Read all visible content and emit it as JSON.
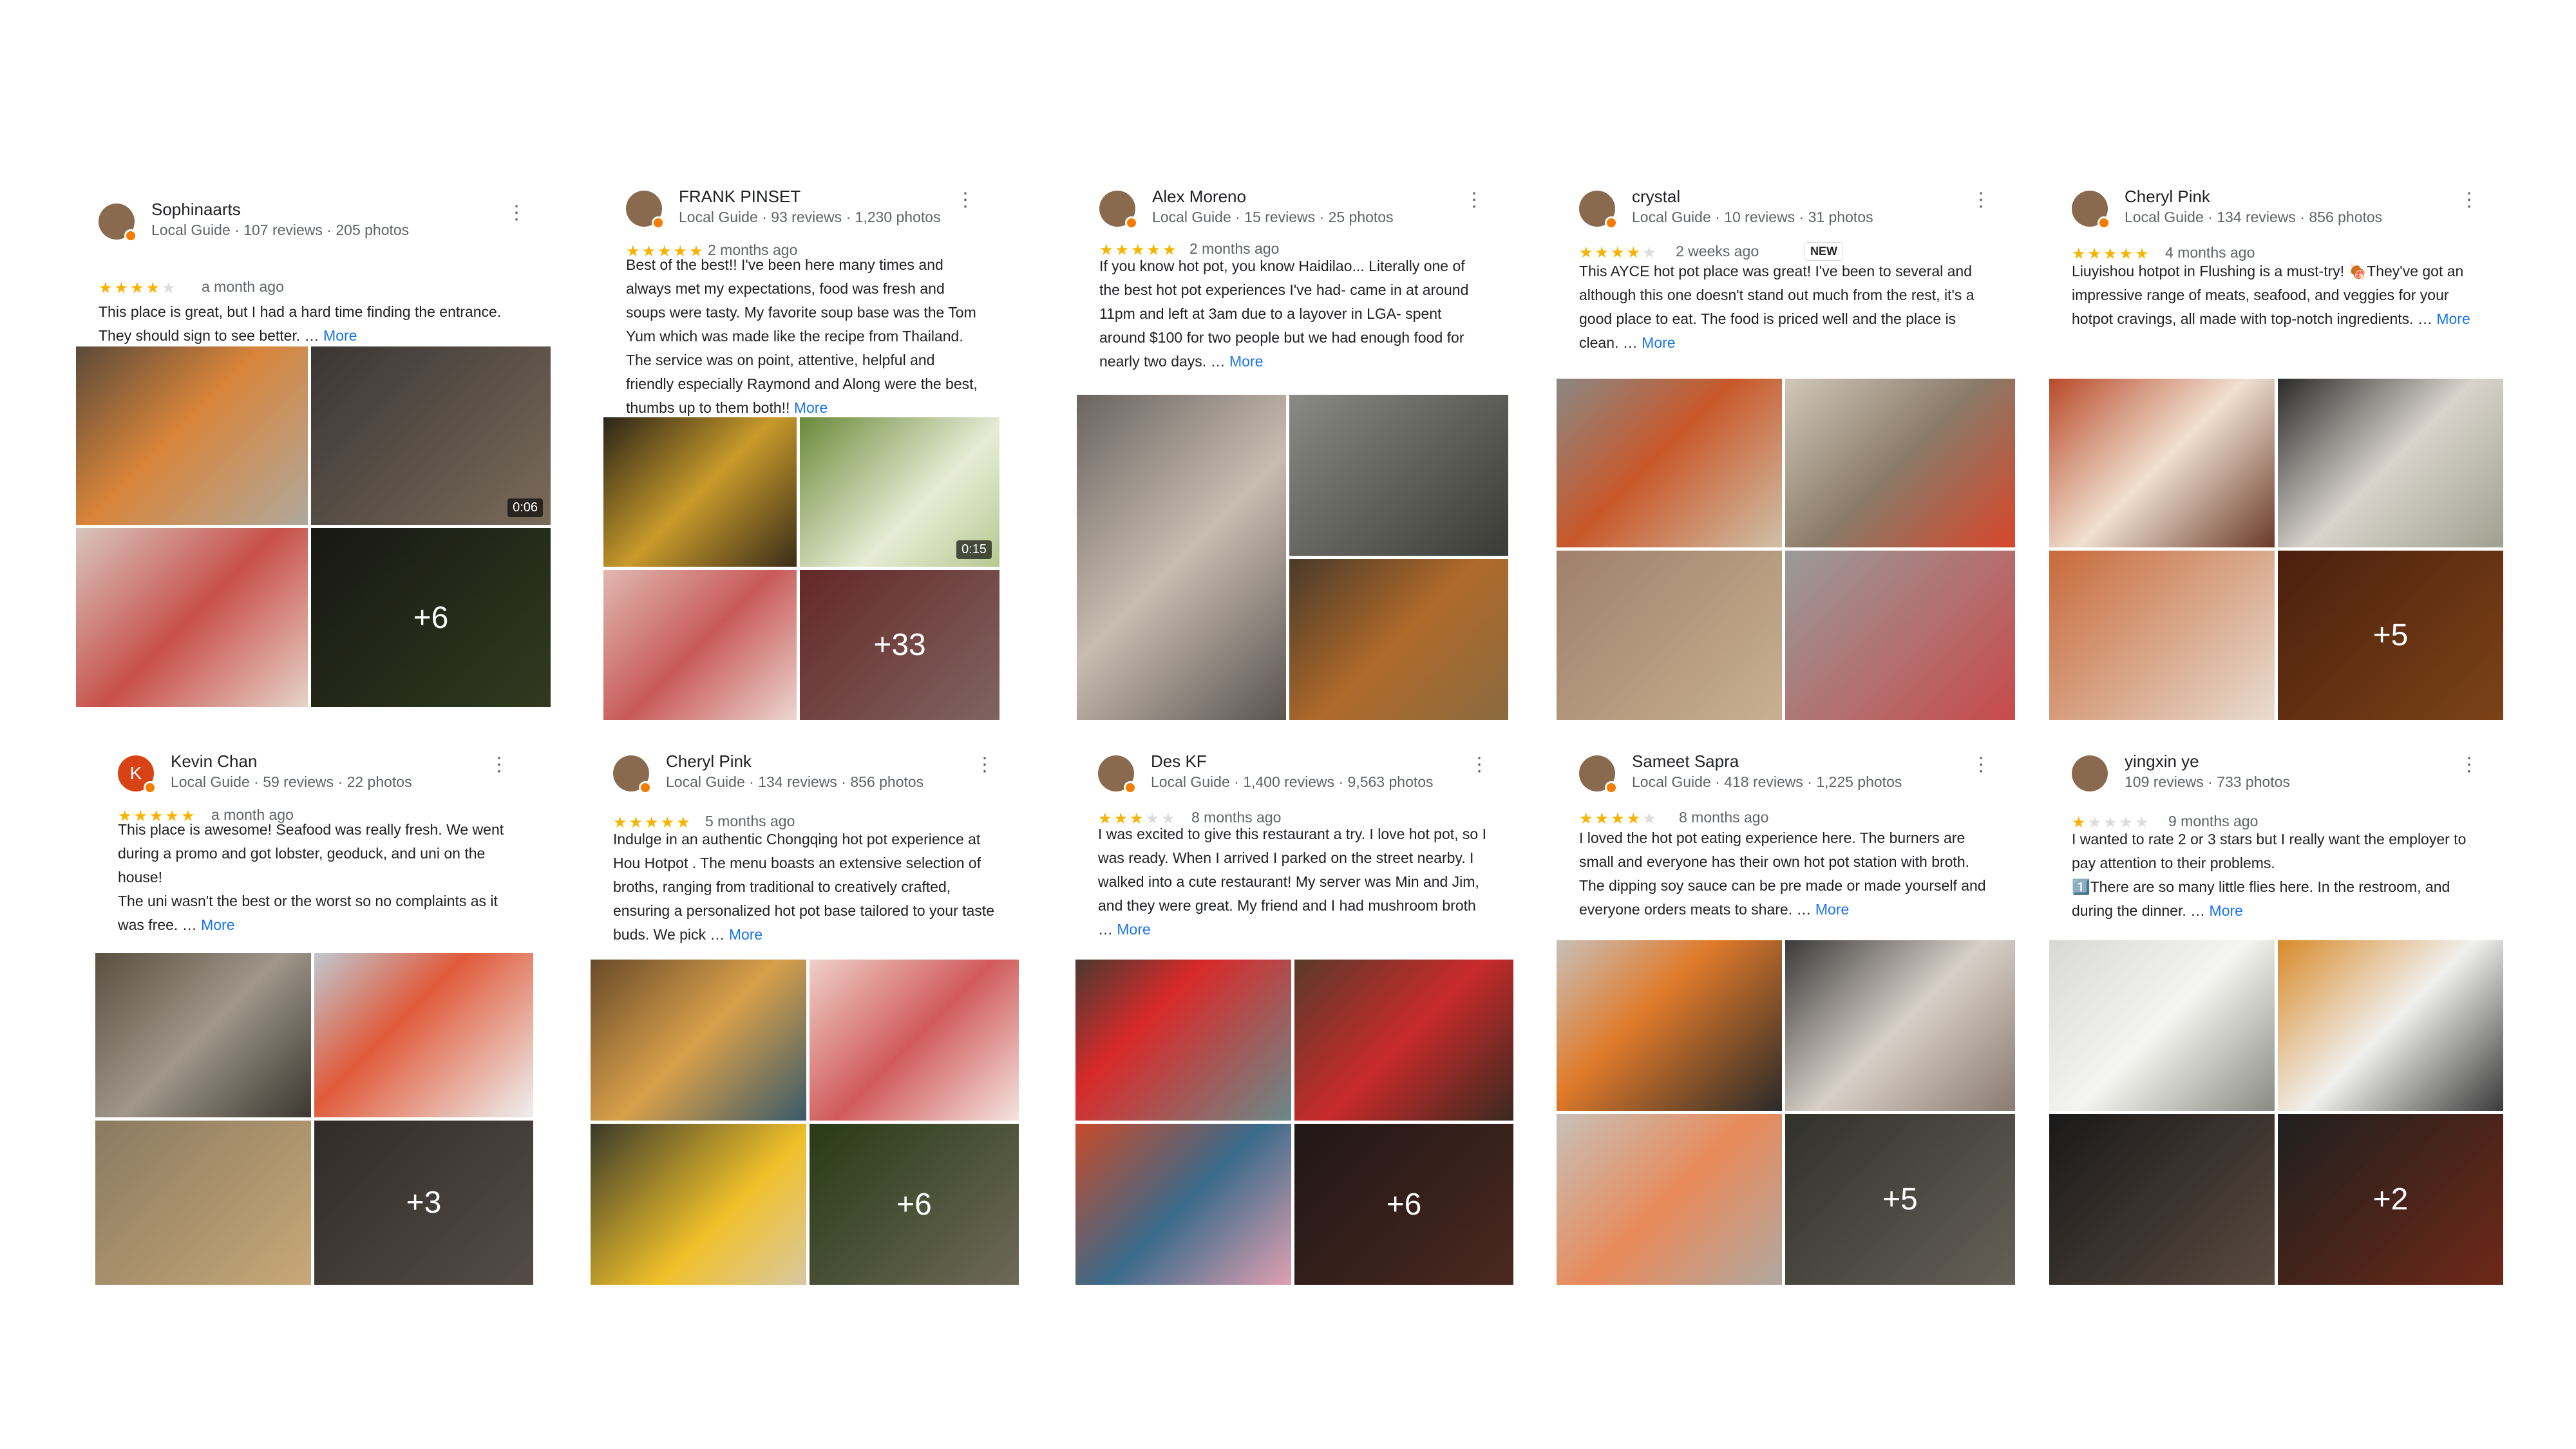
{
  "reviews": [
    {
      "name": "Sophinaarts",
      "meta": "Local Guide · 107 reviews · 205 photos",
      "stars": 4,
      "when": "a month ago",
      "text": "This place is great, but I had a hard time finding the entrance. They should sign to see better. …",
      "more": "More",
      "duration": "0:06",
      "extra": "+6"
    },
    {
      "name": "FRANK PINSET",
      "meta": "Local Guide · 93 reviews · 1,230 photos",
      "stars": 5,
      "when": "2 months ago",
      "text": "Best of the best!! I've been here many times and always met my expectations, food was fresh and soups were tasty. My favorite soup base was the Tom Yum which was made like the recipe from Thailand. The service was on point, attentive, helpful and friendly especially Raymond and Along were the best, thumbs up to them both!!",
      "more": "More",
      "duration": "0:15",
      "extra": "+33"
    },
    {
      "name": "Alex Moreno",
      "meta": "Local Guide · 15 reviews · 25 photos",
      "stars": 5,
      "when": "2 months ago",
      "text": "If you know hot pot, you know Haidilao... Literally one of the best hot pot experiences I've had- came in at around 11pm and left at 3am due to a layover in LGA- spent around $100 for two people but we had enough food for nearly two days. …",
      "more": "More"
    },
    {
      "name": "crystal",
      "meta": "Local Guide · 10 reviews · 31 photos",
      "stars": 4,
      "when": "2 weeks ago",
      "tag": "NEW",
      "text": "This AYCE hot pot place was great! I've been to several and although this one doesn't stand out much from the rest, it's a good place to eat. The food is priced well and the place is clean. …",
      "more": "More"
    },
    {
      "name": "Cheryl Pink",
      "meta": "Local Guide · 134 reviews · 856 photos",
      "stars": 5,
      "when": "4 months ago",
      "text": "Liuyishou hotpot in Flushing is a must-try! 🍖They've got an impressive range of meats, seafood, and veggies for your hotpot cravings, all made with top-notch ingredients. …",
      "more": "More",
      "extra": "+5"
    },
    {
      "name": "Kevin Chan",
      "meta": "Local Guide · 59 reviews · 22 photos",
      "avatar_letter": "K",
      "stars": 5,
      "when": "a month ago",
      "text": "This place is awesome! Seafood was really fresh. We went during a promo and got lobster, geoduck, and uni on the house!\nThe uni wasn't the best or the worst so no complaints as it was free. …",
      "more": "More",
      "extra": "+3"
    },
    {
      "name": "Cheryl Pink",
      "meta": "Local Guide · 134 reviews · 856 photos",
      "stars": 5,
      "when": "5 months ago",
      "text": "Indulge in an authentic Chongqing hot pot experience at Hou Hotpot . The menu boasts an extensive selection of broths, ranging from traditional to creatively crafted, ensuring a personalized hot pot base tailored to your taste buds. We pick …",
      "more": "More",
      "extra": "+6"
    },
    {
      "name": "Des KF",
      "meta": "Local Guide · 1,400 reviews · 9,563 photos",
      "stars": 3,
      "when": "8 months ago",
      "text": "I was excited to give this restaurant a try. I love hot pot, so I was ready. When I arrived I parked on the street nearby. I walked into a cute restaurant! My server was Min and Jim, and they were great. My friend and I had mushroom broth …",
      "more": "More",
      "extra": "+6"
    },
    {
      "name": "Sameet Sapra",
      "meta": "Local Guide · 418 reviews · 1,225 photos",
      "stars": 4,
      "when": "8 months ago",
      "text": "I loved the hot pot eating experience here. The burners are small and everyone has their own hot pot station with broth. The dipping soy sauce can be pre made or made yourself and everyone orders meats to share. …",
      "more": "More",
      "extra": "+5"
    },
    {
      "name": "yingxin ye",
      "meta": "109 reviews · 733 photos",
      "stars": 1,
      "when": "9 months ago",
      "text": "I wanted to rate 2 or 3 stars but I really want the employer to pay attention to their problems.\n1️⃣There are so many little flies here. In the restroom, and during the dinner. …",
      "more": "More",
      "extra": "+2"
    }
  ],
  "star_char": "★",
  "more_dots": "⋮",
  "colors": {
    "star": "#f6b400",
    "star_off": "#dadce0",
    "link": "#1a73e8",
    "badge": "#f57c00"
  }
}
